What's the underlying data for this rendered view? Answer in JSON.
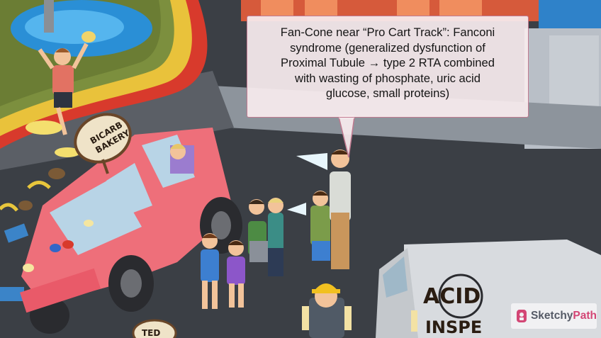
{
  "callout": {
    "lines": [
      "Fan-Cone near “Pro Cart Track”: Fanconi",
      "syndrome (generalized dysfunction of",
      "Proximal Tubule → type 2 RTA combined",
      "with wasting of phosphate, uric acid",
      "glucose, small proteins)"
    ]
  },
  "scene": {
    "bakery_sign_line1": "BICARB",
    "bakery_sign_line2": "BAKERY",
    "truck_text_line1": "ACID",
    "truck_text_line2": "INSPE",
    "bottom_sign_text": "TED"
  },
  "brand": {
    "name_part1": "Sketchy",
    "name_part2": "Path"
  },
  "colors": {
    "accent": "#d34675",
    "van": "#ee6f7a",
    "track_yellow": "#e9c23b",
    "track_red": "#d83a2c",
    "road": "#3a3d42"
  }
}
